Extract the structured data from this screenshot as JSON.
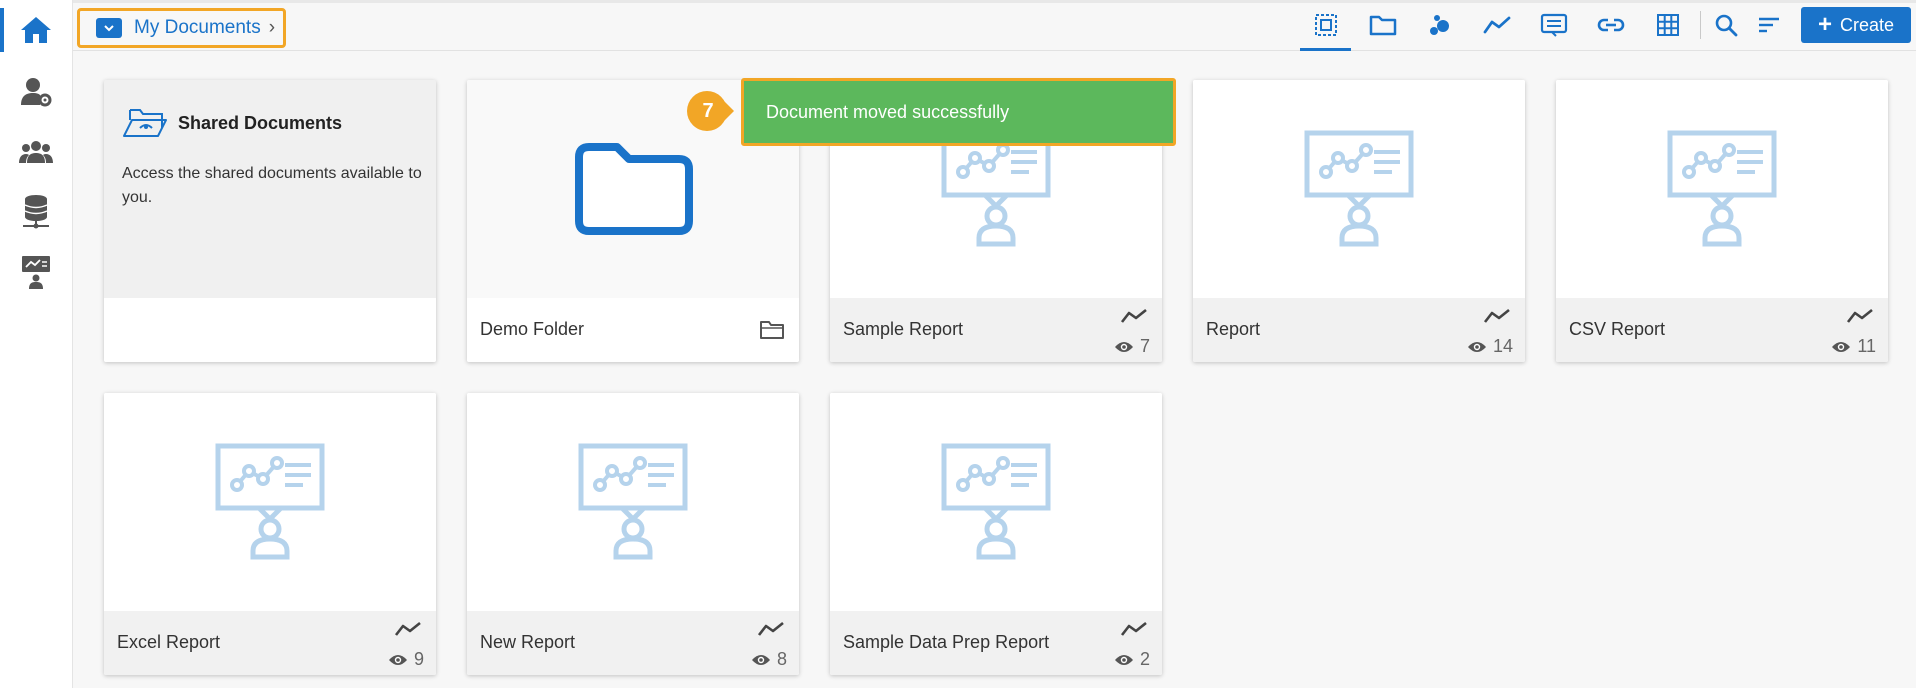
{
  "colors": {
    "accent": "#1a73c9",
    "highlight": "#f2a626",
    "success": "#5cb85c",
    "report_icon": "#b5d3ec"
  },
  "sidebar": {
    "items": [
      {
        "icon": "home-icon",
        "active": true
      },
      {
        "icon": "user-settings-icon"
      },
      {
        "icon": "users-group-icon"
      },
      {
        "icon": "database-network-icon"
      },
      {
        "icon": "presenter-board-icon"
      }
    ]
  },
  "header": {
    "breadcrumb": {
      "label": "My Documents",
      "chevron": "›"
    },
    "toolbar": [
      {
        "icon": "select-all-icon",
        "active": true
      },
      {
        "icon": "folder-icon"
      },
      {
        "icon": "scatter-chart-icon"
      },
      {
        "icon": "line-chart-icon"
      },
      {
        "icon": "list-document-icon"
      },
      {
        "icon": "link-icon"
      },
      {
        "icon": "grid-table-icon"
      },
      {
        "icon": "search-icon"
      },
      {
        "icon": "sort-icon"
      }
    ],
    "create_label": "Create",
    "create_plus": "+"
  },
  "toast": {
    "message": "Document moved successfully",
    "step": "7"
  },
  "cards": {
    "shared": {
      "title": "Shared Documents",
      "description": "Access the shared documents available to you."
    },
    "folder": {
      "name": "Demo Folder"
    },
    "reports": [
      {
        "name": "Sample Report",
        "views": "7"
      },
      {
        "name": "Report",
        "views": "14"
      },
      {
        "name": "CSV Report",
        "views": "11"
      },
      {
        "name": "Excel Report",
        "views": "9"
      },
      {
        "name": "New Report",
        "views": "8"
      },
      {
        "name": "Sample Data Prep Report",
        "views": "2"
      }
    ]
  }
}
